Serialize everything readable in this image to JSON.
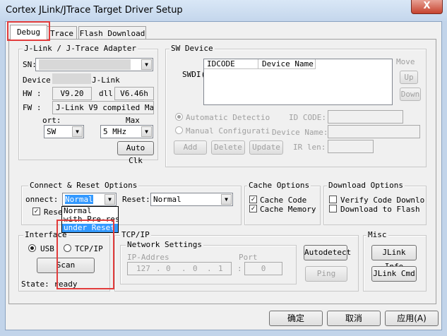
{
  "window": {
    "title": "Cortex JLink/JTrace Target Driver Setup",
    "close_glyph": "X"
  },
  "tabs": [
    "Debug",
    "Trace",
    "Flash Download"
  ],
  "adapter": {
    "title": "J-Link / J-Trace Adapter",
    "sn_label": "SN:",
    "device_label": "Device:",
    "device_value": "J-Link",
    "hw_label": "HW :",
    "hw_value": "V9.20",
    "dll_label": "dll",
    "dll_value": "V6.46h",
    "fw_label": "FW :",
    "fw_value": "J-Link V9 compiled May :",
    "port_label": "ort:",
    "port_value": "SW",
    "max_label": "Max",
    "max_value": "5 MHz",
    "auto_clk": "Auto Clk"
  },
  "sw_device": {
    "title": "SW Device",
    "swdio_label": "SWDI(",
    "col_idcode": "IDCODE",
    "col_device_name": "Device Name",
    "move_label": "Move",
    "up_btn": "Up",
    "down_btn": "Down",
    "auto_detect": "Automatic Detectio",
    "manual_config": "Manual Configurati",
    "id_code_label": "ID CODE:",
    "device_name_label": "Device Name:",
    "ir_len_label": "IR len:",
    "add_btn": "Add",
    "delete_btn": "Delete",
    "update_btn": "Update"
  },
  "connect_reset": {
    "title": "Connect & Reset Options",
    "connect_label": "onnect:",
    "connect_value": "Normal",
    "reset_label": "Reset:",
    "reset_value": "Normal",
    "reset_check_label": "Rese",
    "dropdown_options": [
      "Normal",
      "with Pre-reset",
      "under Reset"
    ],
    "dropdown_selected": 2
  },
  "cache": {
    "title": "Cache Options",
    "cache_code": "Cache Code",
    "cache_memory": "Cache Memory"
  },
  "download": {
    "title": "Download Options",
    "verify": "Verify Code Downlo",
    "download_flash": "Download to Flash"
  },
  "interface": {
    "title": "Interface",
    "usb": "USB",
    "tcpip": "TCP/IP",
    "scan": "Scan",
    "state": "State: ready"
  },
  "tcpip": {
    "title": "TCP/IP",
    "network_settings": "Network Settings",
    "ip_label": "IP-Addres",
    "ip": [
      "127",
      "0",
      "0",
      "1"
    ],
    "port_label": "Port",
    "port_value": "0",
    "autodetect": "Autodetect",
    "ping": "Ping"
  },
  "misc": {
    "title": "Misc",
    "jlink_info": "JLink Info",
    "jlink_cmd": "JLink Cmd"
  },
  "footer": {
    "ok": "确定",
    "cancel": "取消",
    "apply": "应用(A)"
  },
  "colors": {
    "highlight_red": "#e23c3c",
    "selection_blue": "#3399ff"
  }
}
